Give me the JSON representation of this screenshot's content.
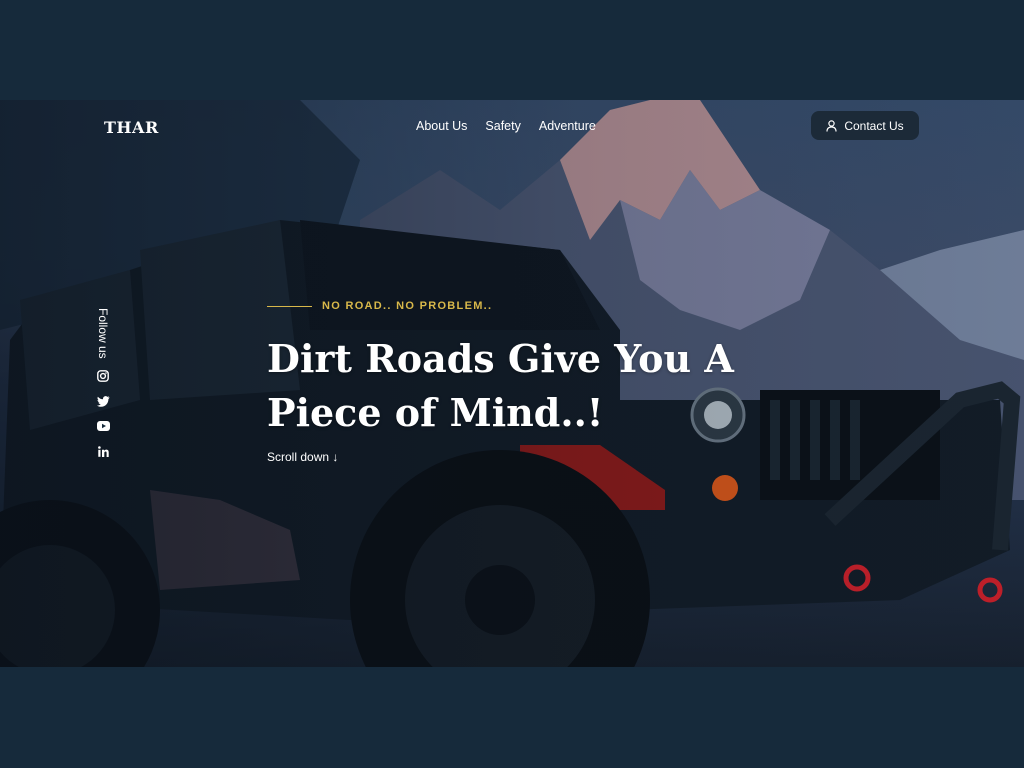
{
  "brand": {
    "logo": "THAR"
  },
  "nav": {
    "items": [
      {
        "label": "About Us"
      },
      {
        "label": "Safety"
      },
      {
        "label": "Adventure"
      }
    ]
  },
  "contact": {
    "label": "Contact Us",
    "icon": "user-icon"
  },
  "hero": {
    "kicker": "NO ROAD.. NO PROBLEM..",
    "headline_line1": "Dirt Roads Give You A",
    "headline_line2": "Piece of Mind..!",
    "scroll_label": "Scroll down ↓"
  },
  "social": {
    "follow_label": "Follow us",
    "icons": [
      "instagram-icon",
      "twitter-icon",
      "youtube-icon",
      "linkedin-icon"
    ]
  },
  "colors": {
    "background": "#162a3b",
    "accent": "#d8b84a",
    "button_bg": "#1c2a38",
    "text": "#ffffff"
  }
}
